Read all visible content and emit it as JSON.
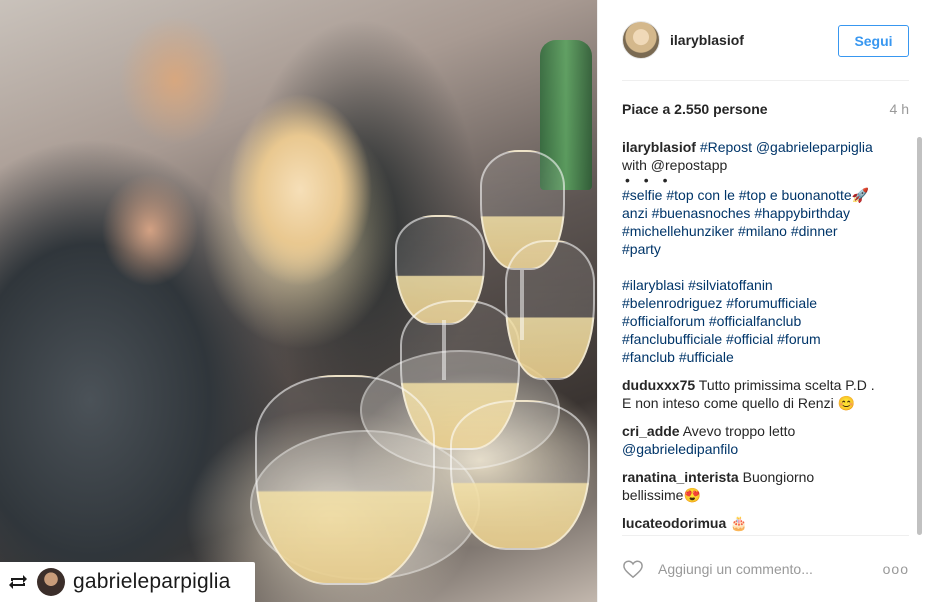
{
  "post": {
    "username": "ilaryblasiof",
    "follow_label": "Segui",
    "likes_text": "Piace a 2.550 persone",
    "time_ago": "4 h"
  },
  "photo": {
    "repost_icon": "repost-icon",
    "repost_username": "gabrieleparpiglia"
  },
  "caption": {
    "user": "ilaryblasiof",
    "line1": "#Repost @gabrieleparpiglia",
    "line2": "with @repostapp",
    "dots": "• • •",
    "line3": "#selfie #top con le #top e buonanotte🚀",
    "line4": "anzi #buenasnoches #happybirthday",
    "line5": "#michellehunziker #milano #dinner",
    "line6": "#party",
    "line7": "#ilaryblasi #silviatoffanin",
    "line8": "#belenrodriguez #forumufficiale",
    "line9": "#officialforum #officialfanclub",
    "line10": "#fanclubufficiale #official #forum",
    "line11": "#fanclub #ufficiale"
  },
  "comments": [
    {
      "user": "duduxxx75",
      "text1": "Tutto primissima scelta P.D .",
      "text2": "E non inteso come quello di Renzi 😊"
    },
    {
      "user": "cri_adde",
      "text1": "Avevo troppo letto",
      "text2": "@gabrieledipanfilo"
    },
    {
      "user": "ranatina_interista",
      "text1": "Buongiorno",
      "text2": "bellissime😍"
    },
    {
      "user": "lucateodorimua",
      "text1": "🎂",
      "text2": ""
    }
  ],
  "footer": {
    "comment_placeholder": "Aggiungi un commento...",
    "more_label": "ooo",
    "heart_icon": "heart-icon"
  },
  "colors": {
    "link_blue": "#003569",
    "follow_blue": "#3897f0",
    "muted": "#999999"
  }
}
